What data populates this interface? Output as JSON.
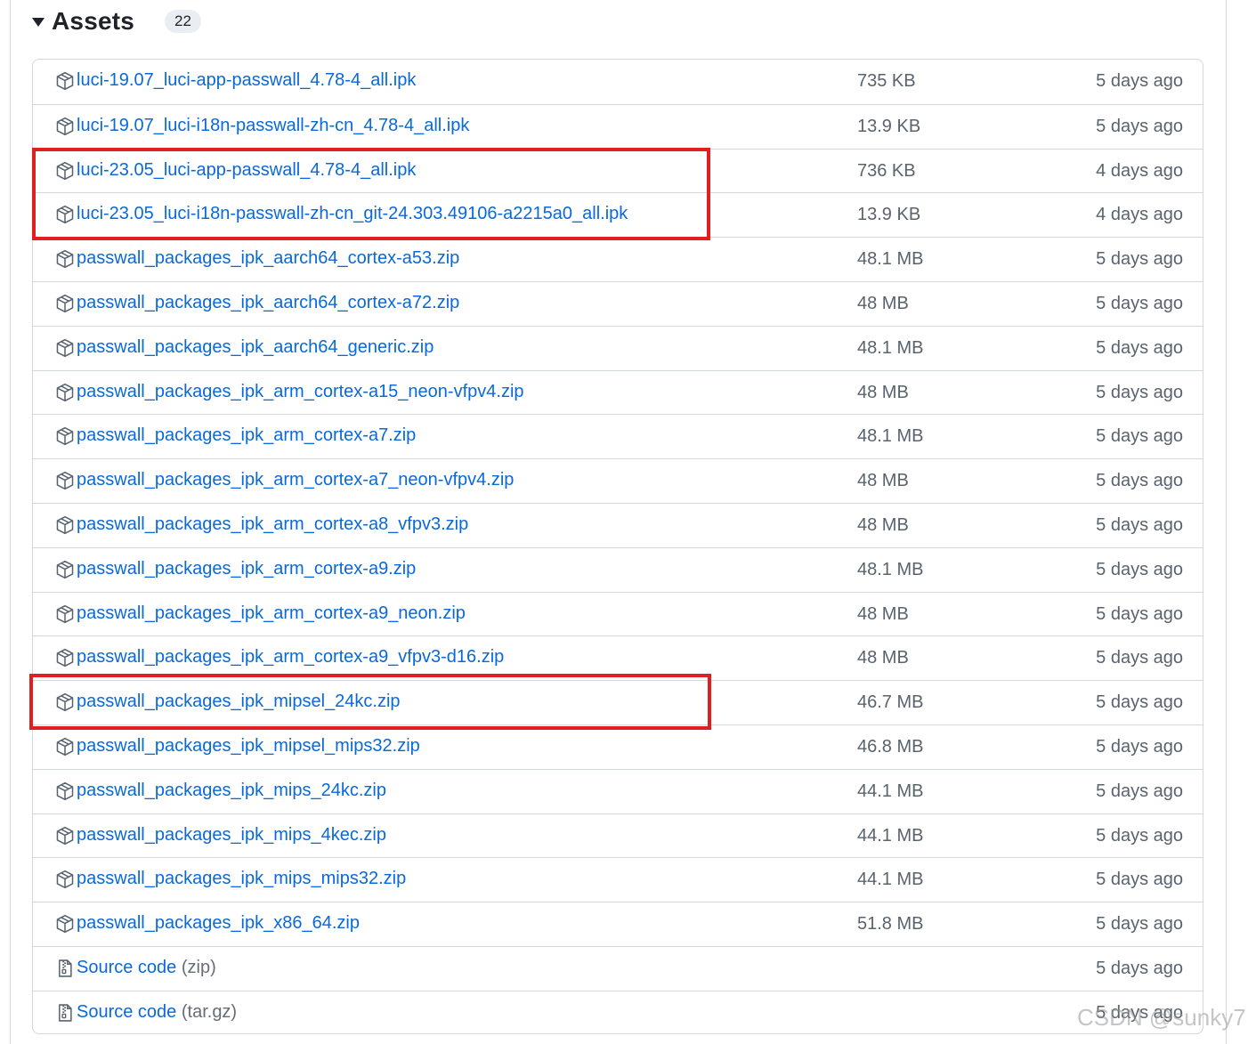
{
  "assets": {
    "title": "Assets",
    "count": "22",
    "rows": [
      {
        "name": "luci-19.07_luci-app-passwall_4.78-4_all.ipk",
        "size": "735 KB",
        "date": "5 days ago"
      },
      {
        "name": "luci-19.07_luci-i18n-passwall-zh-cn_4.78-4_all.ipk",
        "size": "13.9 KB",
        "date": "5 days ago"
      },
      {
        "name": "luci-23.05_luci-app-passwall_4.78-4_all.ipk",
        "size": "736 KB",
        "date": "4 days ago"
      },
      {
        "name": "luci-23.05_luci-i18n-passwall-zh-cn_git-24.303.49106-a2215a0_all.ipk",
        "size": "13.9 KB",
        "date": "4 days ago"
      },
      {
        "name": "passwall_packages_ipk_aarch64_cortex-a53.zip",
        "size": "48.1 MB",
        "date": "5 days ago"
      },
      {
        "name": "passwall_packages_ipk_aarch64_cortex-a72.zip",
        "size": "48 MB",
        "date": "5 days ago"
      },
      {
        "name": "passwall_packages_ipk_aarch64_generic.zip",
        "size": "48.1 MB",
        "date": "5 days ago"
      },
      {
        "name": "passwall_packages_ipk_arm_cortex-a15_neon-vfpv4.zip",
        "size": "48 MB",
        "date": "5 days ago"
      },
      {
        "name": "passwall_packages_ipk_arm_cortex-a7.zip",
        "size": "48.1 MB",
        "date": "5 days ago"
      },
      {
        "name": "passwall_packages_ipk_arm_cortex-a7_neon-vfpv4.zip",
        "size": "48 MB",
        "date": "5 days ago"
      },
      {
        "name": "passwall_packages_ipk_arm_cortex-a8_vfpv3.zip",
        "size": "48 MB",
        "date": "5 days ago"
      },
      {
        "name": "passwall_packages_ipk_arm_cortex-a9.zip",
        "size": "48.1 MB",
        "date": "5 days ago"
      },
      {
        "name": "passwall_packages_ipk_arm_cortex-a9_neon.zip",
        "size": "48 MB",
        "date": "5 days ago"
      },
      {
        "name": "passwall_packages_ipk_arm_cortex-a9_vfpv3-d16.zip",
        "size": "48 MB",
        "date": "5 days ago"
      },
      {
        "name": "passwall_packages_ipk_mipsel_24kc.zip",
        "size": "46.7 MB",
        "date": "5 days ago"
      },
      {
        "name": "passwall_packages_ipk_mipsel_mips32.zip",
        "size": "46.8 MB",
        "date": "5 days ago"
      },
      {
        "name": "passwall_packages_ipk_mips_24kc.zip",
        "size": "44.1 MB",
        "date": "5 days ago"
      },
      {
        "name": "passwall_packages_ipk_mips_4kec.zip",
        "size": "44.1 MB",
        "date": "5 days ago"
      },
      {
        "name": "passwall_packages_ipk_mips_mips32.zip",
        "size": "44.1 MB",
        "date": "5 days ago"
      },
      {
        "name": "passwall_packages_ipk_x86_64.zip",
        "size": "51.8 MB",
        "date": "5 days ago"
      }
    ],
    "source_rows": [
      {
        "name": "Source code",
        "format": "(zip)",
        "date": "5 days ago"
      },
      {
        "name": "Source code",
        "format": "(tar.gz)",
        "date": "5 days ago"
      }
    ]
  },
  "icons": {
    "package": "package-icon",
    "source": "file-zip-icon",
    "caret": "triangle-down-icon"
  },
  "colors": {
    "link": "#0969da",
    "muted": "#59636e",
    "border": "#d0d7de",
    "highlight": "#e02020",
    "badge_bg": "#eaeef2"
  },
  "watermark": "CSDN @sunky7"
}
